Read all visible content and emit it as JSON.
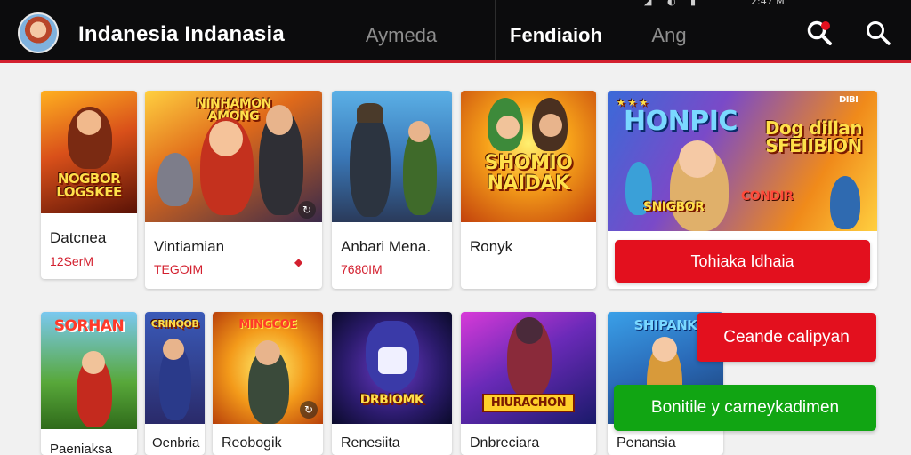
{
  "status_bar": {
    "icons": [
      "signal-icon",
      "wifi-icon",
      "battery-icon"
    ],
    "time": "2:47 M"
  },
  "header": {
    "title": "Indanesia Indanasia",
    "tabs": [
      {
        "label": "Aymeda",
        "active": false
      },
      {
        "label": "Fendiaioh",
        "active": true
      },
      {
        "label": "Ang",
        "active": false
      }
    ],
    "icons": [
      "badge-search-icon",
      "search-icon"
    ],
    "accent": "#d3202f"
  },
  "row1": [
    {
      "title": "Datcnea",
      "sub": "12SerM",
      "art": "NOGBOR\nLOGSKEE"
    },
    {
      "title": "Vintiamian",
      "sub": "TEGOIM",
      "art": "NINHAMON\nAMONG"
    },
    {
      "title": "Anbari Mena.",
      "sub": "7680IM",
      "art": ""
    },
    {
      "title": "Ronyk",
      "sub": "",
      "art": "SHOMIO\nNAIDAK"
    }
  ],
  "featured": {
    "art_top": "HONPIC",
    "art_right": "Dog dillan\nSFEIIBION",
    "art_bottom_left": "SNIGBOR",
    "art_bottom_right": "CONDIR",
    "badge": "DIBI",
    "button": "Tohiaka Idhaia"
  },
  "row2": [
    {
      "title": "Paeniaksa",
      "art": "SORHAN"
    },
    {
      "title": "Oenbria",
      "art": "CRINQOB"
    },
    {
      "title": "Reobogik",
      "art": "MINGCOE"
    },
    {
      "title": "Renesiita",
      "art": "DRBIOMK"
    },
    {
      "title": "Dnbreciara",
      "art": "HIURACHON"
    },
    {
      "title": "Penansia",
      "art": "SHIPANK"
    }
  ],
  "actions": {
    "red_button": "Ceande calipyan",
    "green_button": "Bonitile y carneykadimen"
  },
  "colors": {
    "red": "#e3101e",
    "green": "#11a513",
    "topbar": "#0c0c0d"
  }
}
